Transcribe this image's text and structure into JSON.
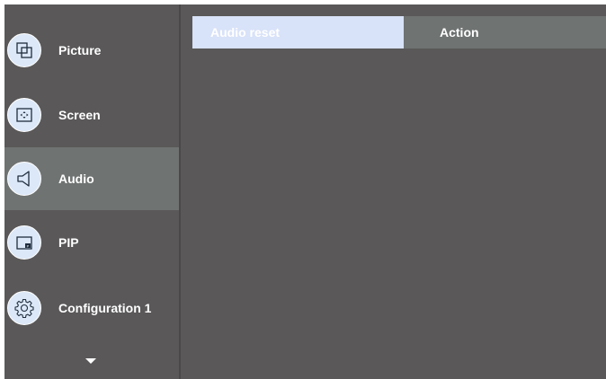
{
  "menu": {
    "items": [
      {
        "label": "Picture",
        "icon": "picture-icon"
      },
      {
        "label": "Screen",
        "icon": "screen-icon"
      },
      {
        "label": "Audio",
        "icon": "speaker-icon",
        "active": true
      },
      {
        "label": "PIP",
        "icon": "pip-icon"
      },
      {
        "label": "Configuration 1",
        "icon": "gear-icon"
      }
    ],
    "more_icon": "chevron-down-icon"
  },
  "header": {
    "selected_label": "Audio reset",
    "action_label": "Action"
  },
  "colors": {
    "background": "#5a5858",
    "active_item": "#6f7372",
    "icon_fill": "#dce8f7",
    "selected_header": "#d8e2f8"
  }
}
